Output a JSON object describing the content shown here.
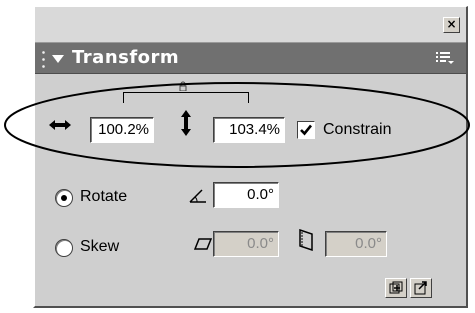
{
  "window": {
    "close_glyph": "×"
  },
  "panel": {
    "title": "Transform"
  },
  "scale": {
    "width_value": "100.2%",
    "height_value": "103.4%",
    "constrain_label": "Constrain",
    "constrain_checked": true
  },
  "rotate": {
    "label": "Rotate",
    "selected": true,
    "value": "0.0°"
  },
  "skew": {
    "label": "Skew",
    "selected": false,
    "horizontal_value": "0.0°",
    "vertical_value": "0.0°"
  },
  "icons": {
    "width": "horizontal-arrows-icon",
    "height": "vertical-arrows-icon",
    "lock": "lock-icon",
    "rotate": "rotate-angle-icon",
    "skew_h": "skew-horizontal-icon",
    "skew_v": "skew-vertical-icon",
    "copy_transform": "copy-transform-icon",
    "reset": "reset-transform-icon",
    "options": "panel-options-icon"
  },
  "colors": {
    "panel_bg": "#cfcfcf",
    "header_bg": "#707070",
    "header_text": "#ffffff",
    "annotation": "#000000"
  }
}
